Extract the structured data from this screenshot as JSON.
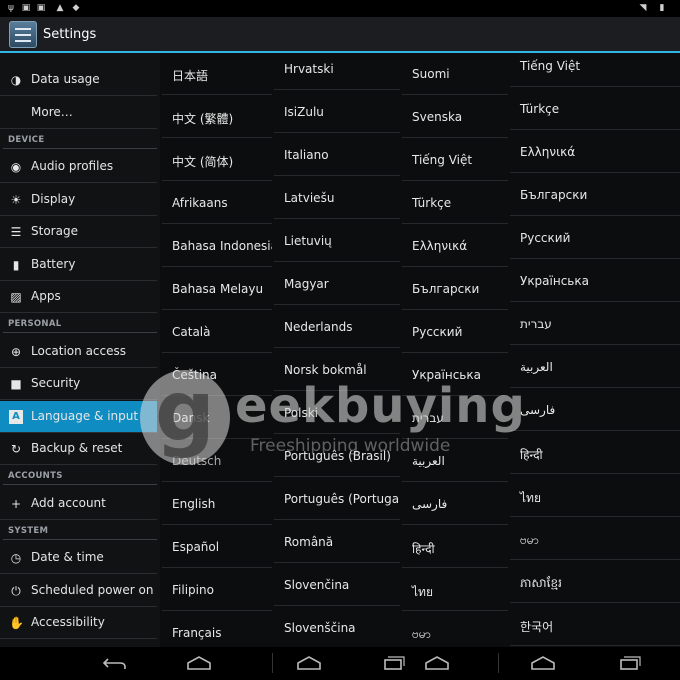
{
  "status_bar": {
    "left_icons": [
      "usb-icon",
      "image-icon",
      "image-icon",
      "warning-icon",
      "notification-icon"
    ],
    "right_icons": [
      "wifi-icon",
      "battery-icon"
    ]
  },
  "action_bar": {
    "title": "Settings",
    "icon": "settings-sliders-icon"
  },
  "sidebar": {
    "top": [
      {
        "label": "Data usage",
        "icon": "data-usage-icon"
      },
      {
        "label": "More…",
        "icon": ""
      }
    ],
    "device_header": "DEVICE",
    "device": [
      {
        "label": "Audio profiles",
        "icon": "audio-icon"
      },
      {
        "label": "Display",
        "icon": "display-icon"
      },
      {
        "label": "Storage",
        "icon": "storage-icon"
      },
      {
        "label": "Battery",
        "icon": "battery-icon"
      },
      {
        "label": "Apps",
        "icon": "apps-icon"
      }
    ],
    "personal_header": "PERSONAL",
    "personal": [
      {
        "label": "Location access",
        "icon": "location-icon"
      },
      {
        "label": "Security",
        "icon": "lock-icon"
      },
      {
        "label": "Language & input",
        "icon": "language-icon",
        "active": true
      },
      {
        "label": "Backup & reset",
        "icon": "backup-icon"
      }
    ],
    "accounts_header": "ACCOUNTS",
    "accounts": [
      {
        "label": "Add account",
        "icon": "add-icon"
      }
    ],
    "system_header": "SYSTEM",
    "system": [
      {
        "label": "Date & time",
        "icon": "clock-icon"
      },
      {
        "label": "Scheduled power on &",
        "icon": "power-icon"
      },
      {
        "label": "Accessibility",
        "icon": "hand-icon"
      }
    ]
  },
  "languages": {
    "col1": [
      "日本語",
      "中文 (繁體)",
      "中文 (简体)",
      "Afrikaans",
      "Bahasa Indonesia",
      "Bahasa Melayu",
      "Català",
      "Čeština",
      "Dansk",
      "Deutsch",
      "English",
      "Español",
      "Filipino",
      "Français"
    ],
    "col2": [
      "Hrvatski",
      "IsiZulu",
      "Italiano",
      "Latviešu",
      "Lietuvių",
      "Magyar",
      "Nederlands",
      "Norsk bokmål",
      "Polski",
      "Português (Brasil)",
      "Português (Portugal)",
      "Română",
      "Slovenčina",
      "Slovenščina"
    ],
    "col3": [
      "Suomi",
      "Svenska",
      "Tiếng Việt",
      "Türkçe",
      "Ελληνικά",
      "Български",
      "Русский",
      "Українська",
      "עברית",
      "العربية",
      "فارسی",
      "हिन्दी",
      "ไทย",
      "ဗမာ"
    ],
    "col4": [
      "Tiếng Việt",
      "Türkçe",
      "Ελληνικά",
      "Български",
      "Русский",
      "Українська",
      "עברית",
      "العربية",
      "فارسی",
      "हिन्दी",
      "ไทย",
      "ဗမာ",
      "ភាសាខ្មែរ",
      "한국어"
    ]
  },
  "watermark": {
    "logo_letter": "g",
    "brand": "eekbuying",
    "tagline": "Freeshipping worldwide"
  },
  "nav_bar": {
    "buttons": [
      "back-icon",
      "home-icon",
      "recent-apps-icon"
    ]
  },
  "colors": {
    "accent": "#33b5e5",
    "active_item": "#0f8dc2"
  }
}
